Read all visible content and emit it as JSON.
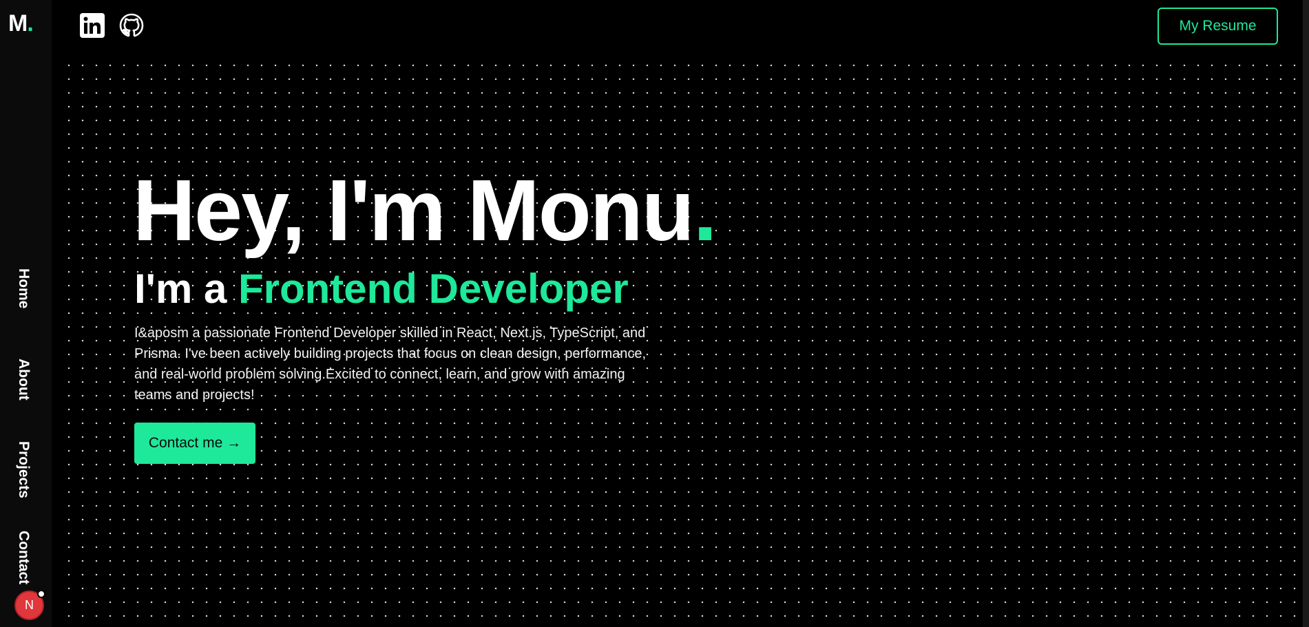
{
  "sidebar": {
    "logo_letter": "M",
    "logo_dot": ".",
    "nav": [
      "Home",
      "About",
      "Projects",
      "Contact"
    ],
    "avatar_letter": "N"
  },
  "topbar": {
    "icons": [
      "linkedin-icon",
      "github-icon"
    ],
    "resume_label": "My Resume"
  },
  "hero": {
    "title": "Hey, I'm Monu",
    "title_dot": ".",
    "subtitle_prefix": "I'm a ",
    "subtitle_accent": "Frontend Developer",
    "description": "I&aposm a passionate Frontend Developer skilled in React, Next.js, TypeScript, and Prisma. I've been actively building projects that focus on clean design, performance, and real-world problem solving.Excited to connect, learn, and grow with amazing teams and projects!",
    "contact_label": "Contact me →"
  },
  "colors": {
    "accent": "#1ee89a",
    "background": "#000000",
    "sidebar": "#0b0b0b",
    "avatar": "#e0373c"
  }
}
